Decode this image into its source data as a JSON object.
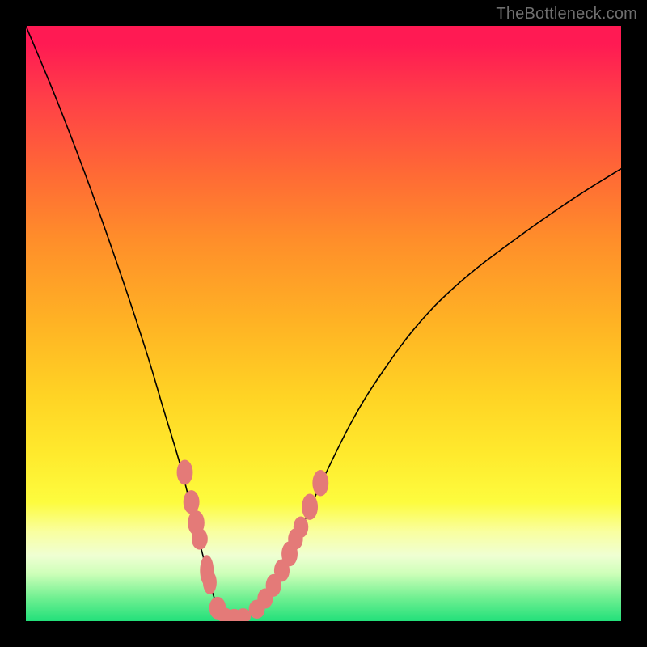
{
  "watermark": "TheBottleneck.com",
  "chart_data": {
    "type": "line",
    "title": "",
    "xlabel": "",
    "ylabel": "",
    "xlim": [
      0,
      100
    ],
    "ylim": [
      0,
      100
    ],
    "series": [
      {
        "name": "bottleneck-curve",
        "x": [
          0,
          5,
          10,
          15,
          20,
          23,
          26,
          28,
          30,
          31,
          32,
          33,
          34,
          36,
          38,
          40,
          43,
          46,
          50,
          55,
          60,
          66,
          73,
          82,
          92,
          100
        ],
        "values": [
          100,
          88,
          75,
          61,
          46,
          36,
          26,
          18,
          10,
          6,
          3,
          1.5,
          1.0,
          1.0,
          1.5,
          3,
          8,
          15,
          24,
          34,
          42,
          50,
          57,
          64,
          71,
          76
        ]
      }
    ],
    "markers": {
      "name": "highlight-dots",
      "color": "#e47a78",
      "points": [
        {
          "x": 26.7,
          "y": 25.0,
          "rx": 1.35,
          "ry": 2.1
        },
        {
          "x": 27.8,
          "y": 20.0,
          "rx": 1.35,
          "ry": 2.0
        },
        {
          "x": 28.6,
          "y": 16.5,
          "rx": 1.4,
          "ry": 2.1
        },
        {
          "x": 29.2,
          "y": 13.8,
          "rx": 1.35,
          "ry": 1.8
        },
        {
          "x": 30.4,
          "y": 8.5,
          "rx": 1.15,
          "ry": 2.6
        },
        {
          "x": 30.9,
          "y": 6.5,
          "rx": 1.15,
          "ry": 2.0
        },
        {
          "x": 32.2,
          "y": 2.2,
          "rx": 1.4,
          "ry": 1.9
        },
        {
          "x": 33.4,
          "y": 1.0,
          "rx": 1.3,
          "ry": 1.25
        },
        {
          "x": 35.0,
          "y": 0.8,
          "rx": 1.3,
          "ry": 1.25
        },
        {
          "x": 36.5,
          "y": 0.9,
          "rx": 1.3,
          "ry": 1.25
        },
        {
          "x": 38.8,
          "y": 2.0,
          "rx": 1.35,
          "ry": 1.6
        },
        {
          "x": 40.2,
          "y": 3.8,
          "rx": 1.3,
          "ry": 1.7
        },
        {
          "x": 41.6,
          "y": 6.0,
          "rx": 1.3,
          "ry": 1.9
        },
        {
          "x": 43.0,
          "y": 8.5,
          "rx": 1.3,
          "ry": 1.9
        },
        {
          "x": 44.3,
          "y": 11.3,
          "rx": 1.35,
          "ry": 2.1
        },
        {
          "x": 45.3,
          "y": 13.8,
          "rx": 1.25,
          "ry": 1.8
        },
        {
          "x": 46.2,
          "y": 15.8,
          "rx": 1.25,
          "ry": 1.8
        },
        {
          "x": 47.7,
          "y": 19.2,
          "rx": 1.35,
          "ry": 2.2
        },
        {
          "x": 49.5,
          "y": 23.2,
          "rx": 1.35,
          "ry": 2.2
        }
      ]
    },
    "gradient_stops": [
      {
        "pos": 0,
        "color": "#ff1a53"
      },
      {
        "pos": 50,
        "color": "#ffb324"
      },
      {
        "pos": 80,
        "color": "#fdfc3e"
      },
      {
        "pos": 100,
        "color": "#22e07a"
      }
    ]
  }
}
